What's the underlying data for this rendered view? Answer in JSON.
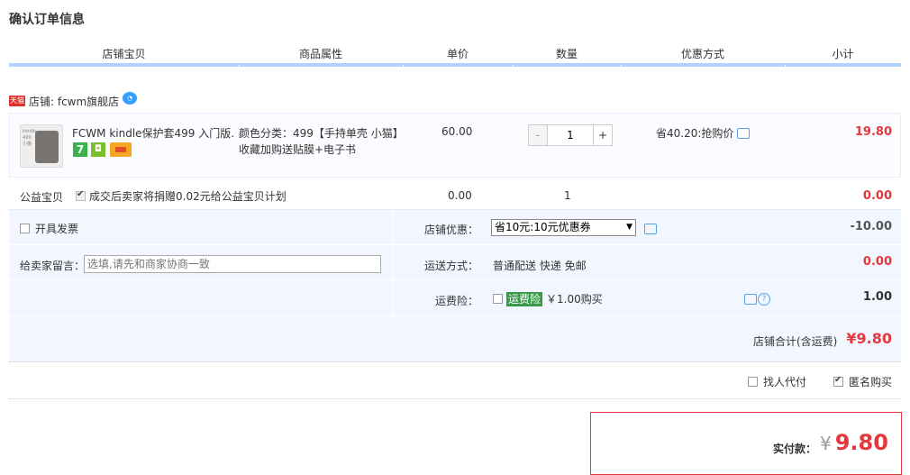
{
  "title": "确认订单信息",
  "headers": [
    "店铺宝贝",
    "商品属性",
    "单价",
    "数量",
    "优惠方式",
    "小计"
  ],
  "shop": {
    "badge": "天猫",
    "name": "店铺: fcwm旗舰店"
  },
  "item": {
    "title": "FCWM kindle保护套499 入门版...",
    "badge7": "7",
    "attr_line1": "颜色分类：499【手持单壳 小猫】",
    "attr_line2": "收藏加购送贴膜+电子书",
    "price": "60.00",
    "qty": "1",
    "minus": "-",
    "plus": "+",
    "promo": "省40.20:抢购价",
    "subtotal": "19.80"
  },
  "charity": {
    "label": "公益宝贝",
    "desc": "成交后卖家将捐赠0.02元给公益宝贝计划",
    "price": "0.00",
    "qty": "1",
    "subtotal": "0.00"
  },
  "options": {
    "invoice_label": "开具发票",
    "msg_label": "给卖家留言：",
    "msg_placeholder": "选填,请先和商家协商一致",
    "coupon_label": "店铺优惠：",
    "coupon_value": "省10元:10元优惠券",
    "coupon_amount": "-10.00",
    "ship_label": "运送方式：",
    "ship_value": "普通配送 快递 免邮",
    "ship_amount": "0.00",
    "insurance_label": "运费险：",
    "insurance_tag": "运费险",
    "insurance_text": "￥1.00购买",
    "insurance_amount": "1.00",
    "total_label": "店铺合计(含运费)",
    "total_value": "¥9.80"
  },
  "footer": {
    "proxy_label": "找人代付",
    "anon_label": "匿名购买",
    "pay_label": "实付款：",
    "pay_currency": "¥",
    "pay_value": "9.80"
  }
}
